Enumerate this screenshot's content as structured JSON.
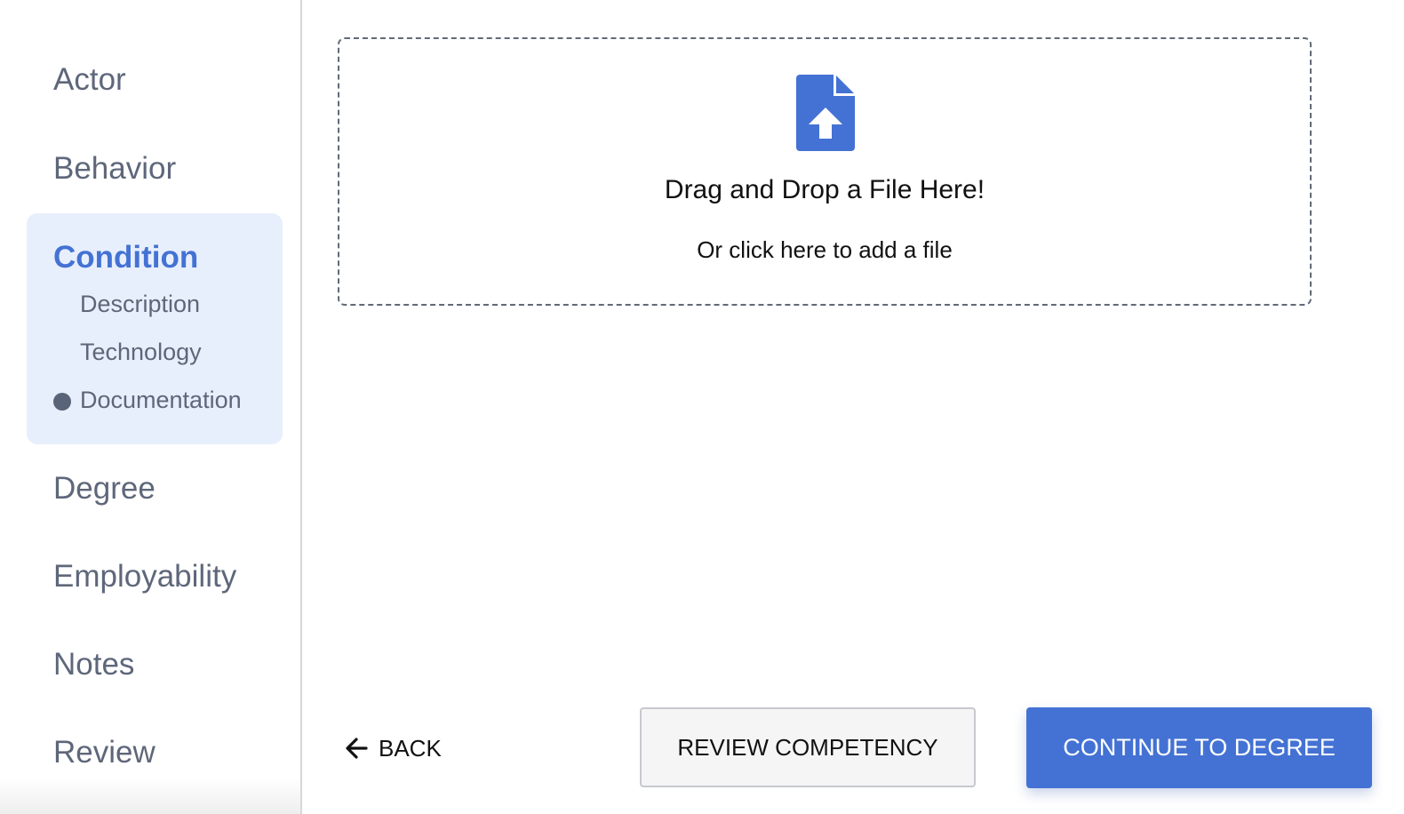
{
  "sidebar": {
    "items_top": [
      {
        "label": "Actor"
      },
      {
        "label": "Behavior"
      }
    ],
    "active_group": {
      "label": "Condition",
      "sub_items": [
        {
          "label": "Description"
        },
        {
          "label": "Technology"
        },
        {
          "label": "Documentation",
          "current": true
        }
      ]
    },
    "items_bottom": [
      {
        "label": "Degree"
      },
      {
        "label": "Employability"
      },
      {
        "label": "Notes"
      },
      {
        "label": "Review"
      }
    ]
  },
  "dropzone": {
    "icon": "file-upload-icon",
    "title": "Drag and Drop a File Here!",
    "subtitle": "Or click here to add a file"
  },
  "actions": {
    "back_label": "BACK",
    "review_label": "REVIEW COMPETENCY",
    "continue_label": "CONTINUE TO DEGREE"
  },
  "colors": {
    "accent": "#4472d4",
    "active_bg": "#e8effc",
    "nav_text": "#5e677a"
  }
}
